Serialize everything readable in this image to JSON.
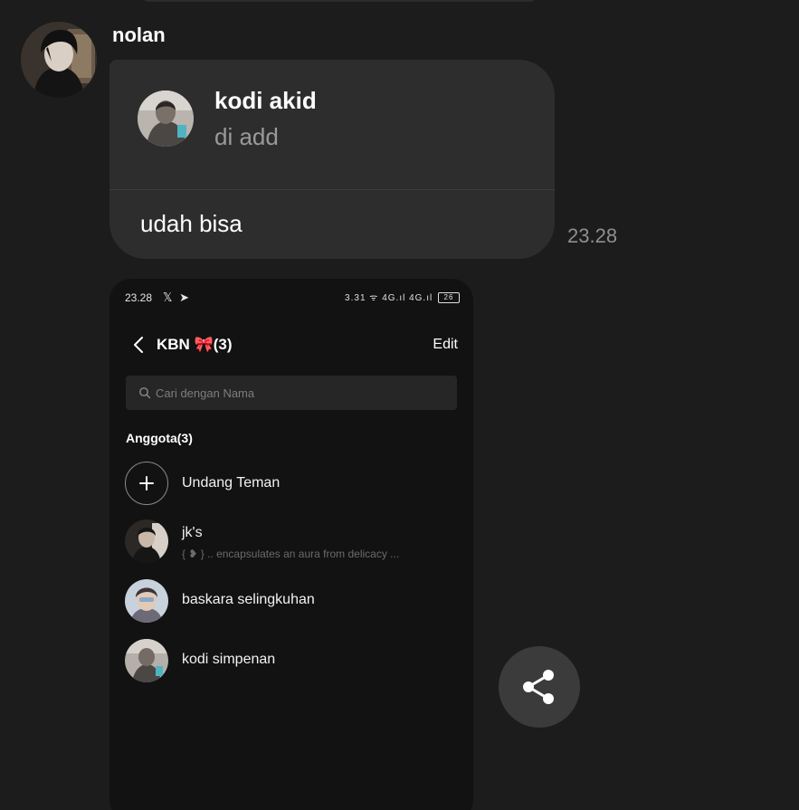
{
  "chat": {
    "sender_name": "nolan",
    "message": {
      "contact_name": "kodi akid",
      "contact_sub": "di add",
      "text": "udah bisa",
      "time": "23.28"
    }
  },
  "screenshot": {
    "status_bar": {
      "time": "23.28",
      "left_icons": "𝕏 ➤",
      "right_icons": "3.31 ᯤ 4G.ıl 4G.ıl",
      "battery": "26"
    },
    "header": {
      "title": "KBN 🎀(3)",
      "edit_label": "Edit"
    },
    "search": {
      "placeholder": "Cari dengan Nama"
    },
    "section_title": "Anggota(3)",
    "invite_label": "Undang Teman",
    "members": [
      {
        "name": "jk's",
        "status": "{ ❥ } .. encapsulates an aura from delicacy ..."
      },
      {
        "name": "baskara selingkuhan",
        "status": ""
      },
      {
        "name": "kodi simpenan",
        "status": ""
      }
    ]
  },
  "colors": {
    "background": "#1c1c1c",
    "bubble": "#2d2d2d",
    "fab": "#3b3b3b"
  },
  "icons": {
    "back": "chevron-left-icon",
    "search": "search-icon",
    "add": "plus-icon",
    "share": "share-icon"
  }
}
